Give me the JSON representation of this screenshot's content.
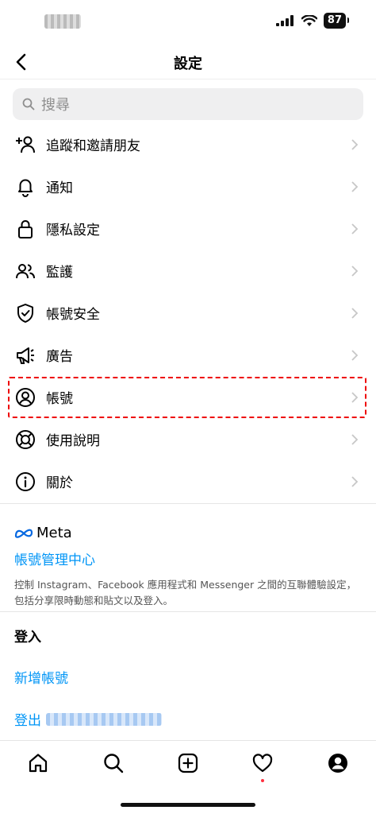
{
  "status": {
    "battery": "87"
  },
  "nav": {
    "title": "設定"
  },
  "search": {
    "placeholder": "搜尋"
  },
  "menu": [
    {
      "label": "追蹤和邀請朋友",
      "icon": "add-person-icon"
    },
    {
      "label": "通知",
      "icon": "bell-icon"
    },
    {
      "label": "隱私設定",
      "icon": "lock-icon"
    },
    {
      "label": "監護",
      "icon": "people-icon"
    },
    {
      "label": "帳號安全",
      "icon": "shield-check-icon"
    },
    {
      "label": "廣告",
      "icon": "megaphone-icon"
    },
    {
      "label": "帳號",
      "icon": "profile-circle-icon"
    },
    {
      "label": "使用說明",
      "icon": "lifebuoy-icon"
    },
    {
      "label": "關於",
      "icon": "info-icon"
    }
  ],
  "meta": {
    "logo_text": "Meta",
    "accounts_center": "帳號管理中心",
    "description": "控制 Instagram、Facebook 應用程式和 Messenger 之間的互聯體驗設定，包括分享限時動態和貼文以及登入。"
  },
  "login": {
    "heading": "登入",
    "add_account": "新增帳號",
    "logout_prefix": "登出"
  },
  "tabs": [
    "home-icon",
    "search-icon",
    "create-icon",
    "heart-icon",
    "profile-icon"
  ],
  "colors": {
    "accent": "#0095f6",
    "highlight": "#e00000",
    "notification_dot": "#ff3040"
  }
}
